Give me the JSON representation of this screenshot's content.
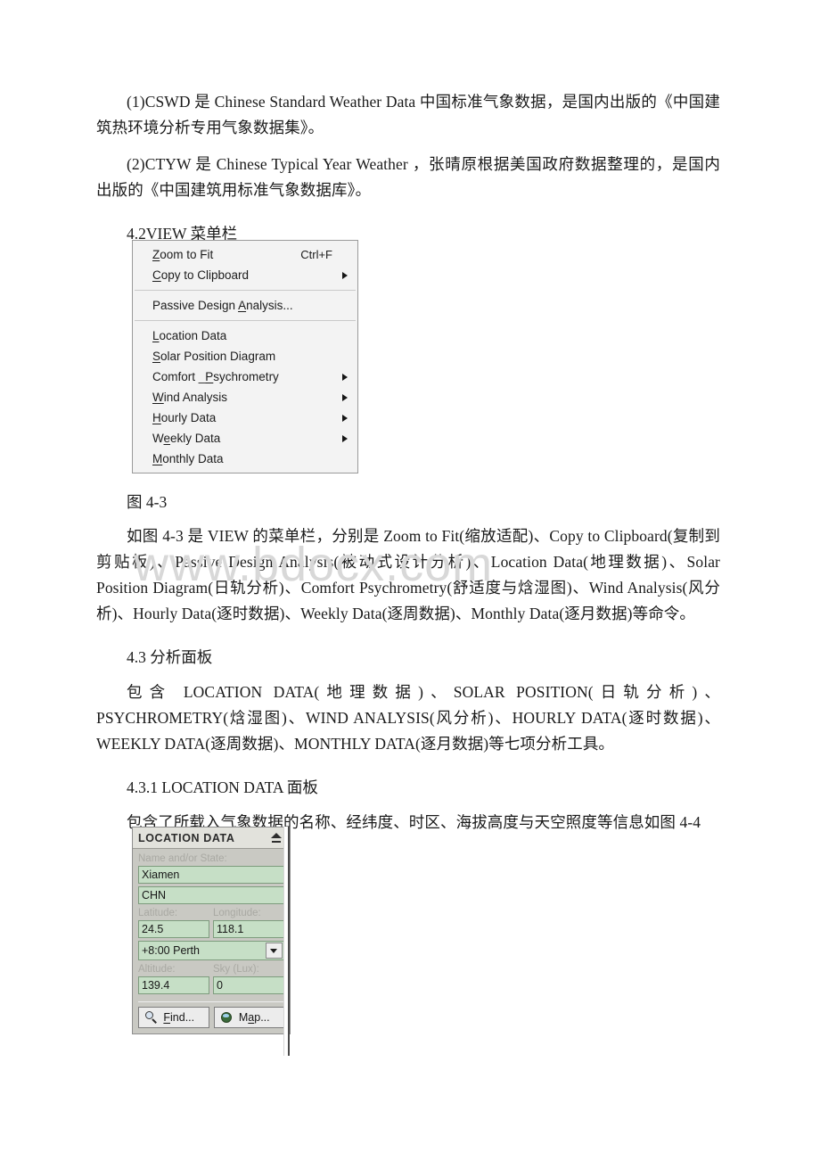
{
  "document": {
    "watermark": "www.bdocx.com",
    "paragraphs": [
      {
        "id": "p-cswd",
        "text": "(1)CSWD 是 Chinese Standard Weather Data 中国标准气象数据，是国内出版的《中国建筑热环境分析专用气象数据集》。"
      },
      {
        "id": "p-ctyw",
        "text": "(2)CTYW 是 Chinese Typical Year Weather ，张晴原根据美国政府数据整理的，是国内出版的《中国建筑用标准气象数据库》。"
      }
    ],
    "heading_42": "4.2VIEW 菜单栏",
    "figure_43_caption": "图 4-3",
    "p_menu_description": "如图 4-3 是 VIEW 的菜单栏，分别是 Zoom to Fit(缩放适配)、Copy to Clipboard(复制到剪贴板)、Passive Design Analysis(被动式设计分析)、Location Data(地理数据)、Solar Position Diagram(日轨分析)、Comfort Psychrometry(舒适度与焓湿图)、Wind Analysis(风分析)、Hourly Data(逐时数据)、Weekly Data(逐周数据)、Monthly Data(逐月数据)等命令。",
    "heading_43": "4.3 分析面板",
    "p_panels_description": "包含 LOCATION DATA(地理数据)、SOLAR POSITION(日轨分析)、PSYCHROMETRY(焓湿图)、WIND ANALYSIS(风分析)、HOURLY DATA(逐时数据)、WEEKLY DATA(逐周数据)、MONTHLY DATA(逐月数据)等七项分析工具。",
    "heading_431": "4.3.1 LOCATION DATA 面板",
    "p_location_description": "包含了所载入气象数据的名称、经纬度、时区、海拔高度与天空照度等信息如图 4-4"
  },
  "view_menu": {
    "groups": [
      {
        "items": [
          {
            "accel": "Z",
            "rest": "oom to Fit",
            "shortcut": "Ctrl+F",
            "submenu": false
          },
          {
            "accel": "C",
            "rest": "opy to Clipboard",
            "shortcut": "",
            "submenu": true
          }
        ]
      },
      {
        "items": [
          {
            "pre": "Passive Design ",
            "accel": "A",
            "rest": "nalysis...",
            "shortcut": "",
            "submenu": false
          }
        ]
      },
      {
        "items": [
          {
            "accel": "L",
            "rest": "ocation Data",
            "shortcut": "",
            "submenu": false
          },
          {
            "accel": "S",
            "rest": "olar Position Diagram",
            "shortcut": "",
            "submenu": false
          },
          {
            "pre": "Comfort _",
            "accel": "P",
            "rest": "sychrometry",
            "shortcut": "",
            "submenu": true
          },
          {
            "accel": "W",
            "rest": "ind Analysis",
            "shortcut": "",
            "submenu": true
          },
          {
            "accel": "H",
            "rest": "ourly Data",
            "shortcut": "",
            "submenu": true
          },
          {
            "pre": "W",
            "accel": "e",
            "rest": "ekly Data",
            "shortcut": "",
            "submenu": true
          },
          {
            "accel": "M",
            "rest": "onthly Data",
            "shortcut": "",
            "submenu": false
          }
        ]
      }
    ]
  },
  "location_panel": {
    "title": "LOCATION DATA",
    "collapse_icon": "eject-icon",
    "fields": {
      "name_label": "Name and/or State:",
      "name_value": "Xiamen",
      "country_value": "CHN",
      "latitude_label": "Latitude:",
      "latitude_value": "24.5",
      "longitude_label": "Longitude:",
      "longitude_value": "118.1",
      "timezone_value": "+8:00 Perth",
      "altitude_label": "Altitude:",
      "altitude_value": "139.4",
      "sky_label": "Sky (Lux):",
      "sky_value": "0"
    },
    "buttons": {
      "find": {
        "accel": "F",
        "rest": "ind...",
        "icon": "magnifier-icon"
      },
      "map": {
        "pre": "M",
        "accel": "a",
        "rest": "p...",
        "icon": "globe-icon"
      }
    }
  },
  "colors": {
    "page_bg": "#ffffff",
    "text": "#1a1a1a",
    "watermark": "#d8d8d8",
    "menu_bg": "#f3f3f3",
    "menu_border": "#9a9a9a",
    "panel_bg": "#c9c9c3",
    "panel_header_bg": "#e2e2dc",
    "field_bg": "#c6dfc6",
    "field_border": "#7d9c7d",
    "field_label": "#a9a9a3",
    "button_bg": "#ececec"
  }
}
